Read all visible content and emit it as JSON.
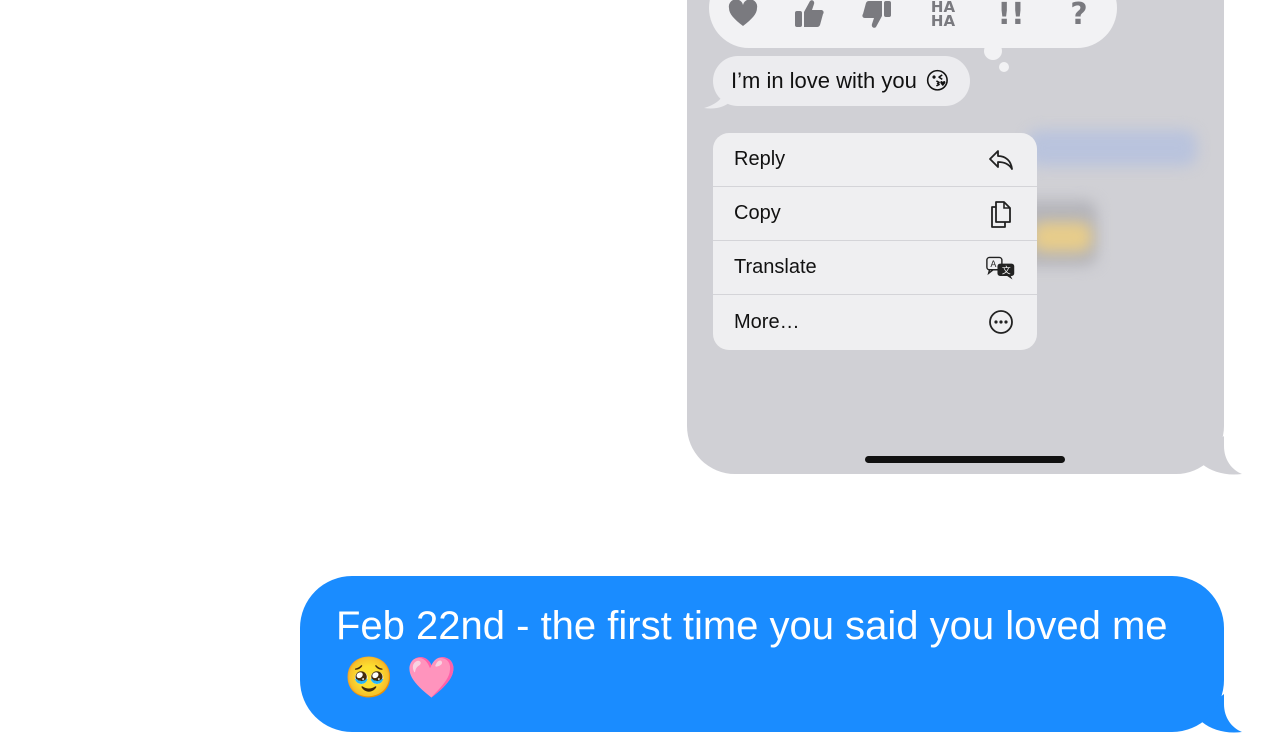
{
  "tapback": {
    "reactions": [
      {
        "name": "heart-icon"
      },
      {
        "name": "thumbs-up-icon"
      },
      {
        "name": "thumbs-down-icon"
      },
      {
        "name": "haha-icon",
        "text_top": "HA",
        "text_bottom": "HA"
      },
      {
        "name": "exclamation-icon",
        "text": "!!"
      },
      {
        "name": "question-icon",
        "text": "?"
      }
    ]
  },
  "received_message": {
    "text": "I’m in love with you",
    "emoji": "😘"
  },
  "context_menu": {
    "items": [
      {
        "label": "Reply",
        "icon": "reply-icon"
      },
      {
        "label": "Copy",
        "icon": "copy-icon"
      },
      {
        "label": "Translate",
        "icon": "translate-icon"
      },
      {
        "label": "More…",
        "icon": "more-icon"
      }
    ]
  },
  "sent_message": {
    "text": "Feb 22nd - the first time you said you loved me",
    "emojis": "🥹 🩷"
  },
  "colors": {
    "sent_bubble": "#1a8cff",
    "image_background": "#d0d0d5",
    "menu_background": "#efeff1",
    "icon_grey": "#7a7a7f"
  }
}
